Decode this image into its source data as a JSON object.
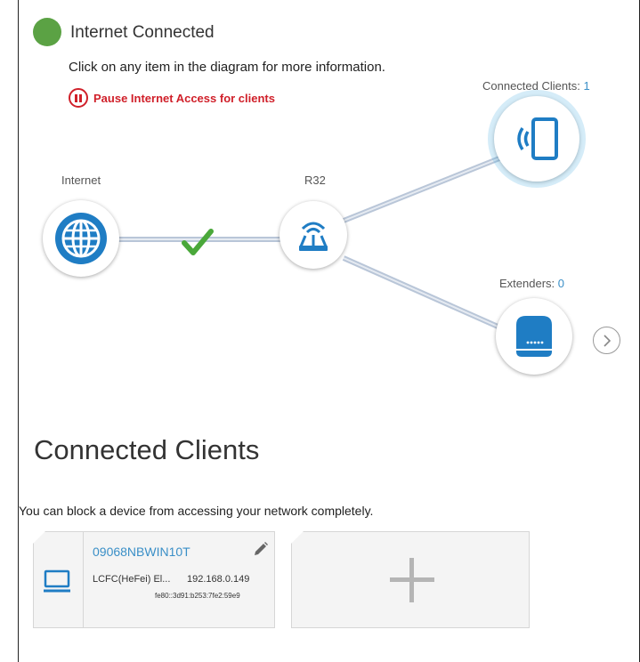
{
  "status": {
    "text": "Internet Connected",
    "color": "#5ba244"
  },
  "hint": "Click on any item in the diagram for more information.",
  "pause_button": {
    "label": "Pause Internet Access for clients",
    "icon": "pause-icon"
  },
  "diagram": {
    "internet": {
      "label": "Internet",
      "icon": "globe-icon"
    },
    "router": {
      "label": "R32",
      "icon": "router-icon"
    },
    "link_status_icon": "checkmark-icon",
    "clients": {
      "label": "Connected Clients:",
      "count": "1",
      "icon": "phone-wireless-icon"
    },
    "extenders": {
      "label": "Extenders:",
      "count": "0",
      "icon": "extender-icon"
    },
    "next_icon": "chevron-right-icon"
  },
  "section": {
    "title": "Connected Clients",
    "note": "You can block a device from accessing your network completely."
  },
  "clients": [
    {
      "name": "09068NBWIN10T",
      "vendor": "LCFC(HeFei) El...",
      "ipv4": "192.168.0.149",
      "ipv6": "fe80::3d91:b253:7fe2:59e9",
      "icon": "laptop-icon"
    }
  ],
  "add_card": {
    "icon": "plus-icon"
  },
  "colors": {
    "accent": "#3a8fc7",
    "alert": "#d0202a",
    "connected": "#5ba244",
    "node_blue": "#1f7dc4"
  }
}
